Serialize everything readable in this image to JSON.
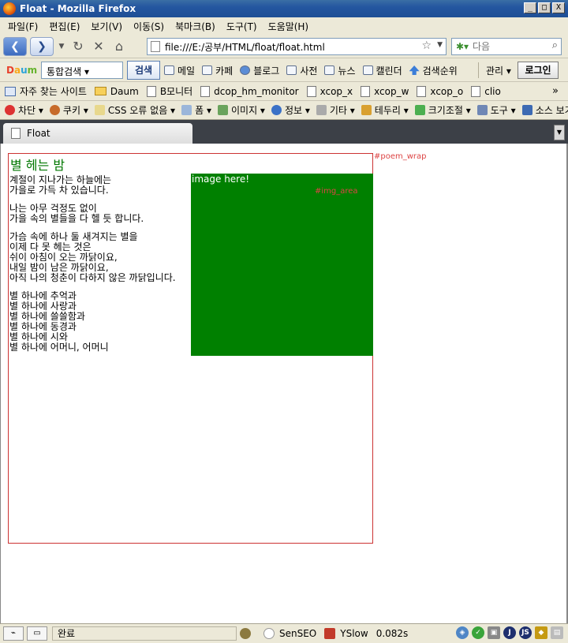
{
  "window": {
    "title": "Float - Mozilla Firefox",
    "minimize": "_",
    "maximize": "□",
    "close": "X"
  },
  "menu": [
    "파일(F)",
    "편집(E)",
    "보기(V)",
    "이동(S)",
    "북마크(B)",
    "도구(T)",
    "도움말(H)"
  ],
  "nav": {
    "url": "file:///E:/공부/HTML/float/float.html",
    "search_placeholder": "다음"
  },
  "daum": {
    "logo": [
      "D",
      "a",
      "u",
      "m"
    ],
    "search_select": "통합검색 ▾",
    "search_button": "검색",
    "tools": [
      "메일",
      "카페",
      "블로그",
      "사전",
      "뉴스",
      "캘린더",
      "검색순위"
    ],
    "manage": "관리 ▾",
    "login": "로그인"
  },
  "bookmarks": [
    "자주 찾는 사이트",
    "Daum",
    "B모니터",
    "dcop_hm_monitor",
    "xcop_x",
    "xcop_w",
    "xcop_o",
    "clio"
  ],
  "bookmarks_more": "»",
  "webdev": [
    "차단 ▾",
    "쿠키 ▾",
    "CSS 오류 없음 ▾",
    "폼 ▾",
    "이미지 ▾",
    "정보 ▾",
    "기타 ▾",
    "테두리 ▾",
    "크기조절 ▾",
    "도구 ▾",
    "소스 보기"
  ],
  "tab": {
    "title": "Float"
  },
  "page": {
    "title": "별 헤는 밤",
    "stanzas": [
      [
        "계절이 지나가는 하늘에는",
        "가을로 가득 차 있습니다."
      ],
      [
        "나는 아무 걱정도 없이",
        "가을 속의 별들을 다 헬 듯 합니다."
      ],
      [
        "가슴 속에 하나 둘 새겨지는 별을",
        "이제 다 못 헤는 것은",
        "쉬이 아침이 오는 까닭이요,",
        "내일 밤이 남은 까닭이요,",
        "아직 나의 청춘이 다하지 않은 까닭입니다."
      ],
      [
        "별 하나에 추억과",
        "별 하나에 사랑과",
        "별 하나에 쓸쓸함과",
        "별 하나에 동경과",
        "별 하나에 시와",
        "별 하나에 어머니, 어머니"
      ]
    ],
    "image_text": "image here!",
    "image_label": "#img_area",
    "wrap_label": "#poem_wrap"
  },
  "status": {
    "text": "완료",
    "senseo": "SenSEO",
    "yslow": "YSlow",
    "time": "0.082s"
  }
}
